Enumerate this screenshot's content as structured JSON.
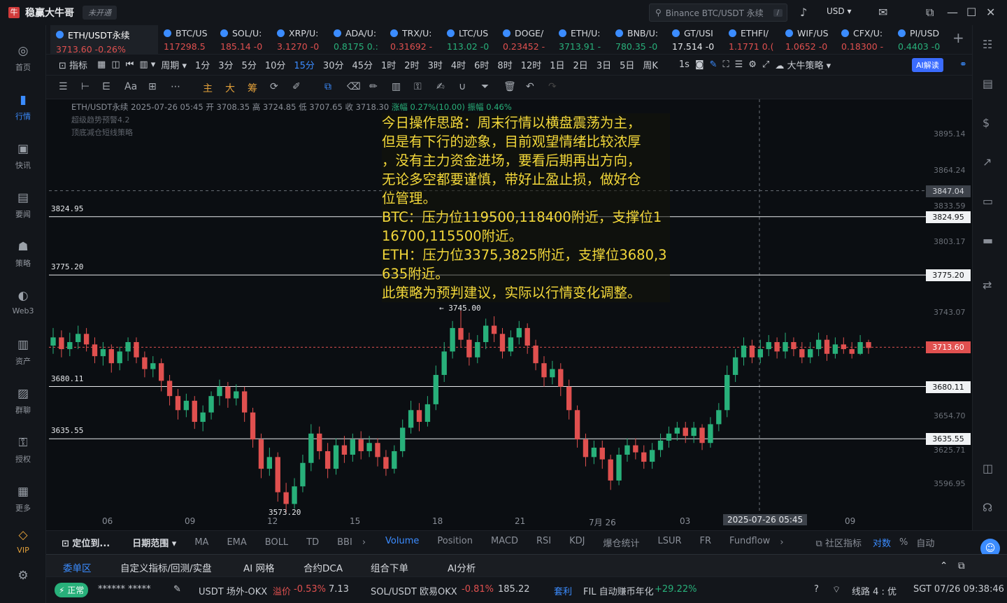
{
  "titlebar": {
    "app_title": "稳赢大牛哥",
    "not_open": "未开通",
    "search_placeholder": "Binance BTC/USDT 永续",
    "currency": "USD"
  },
  "sidebar": {
    "items": [
      {
        "label": "首页",
        "icon": "home-icon"
      },
      {
        "label": "行情",
        "icon": "chart-bars-icon",
        "active": true
      },
      {
        "label": "快讯",
        "icon": "news-icon"
      },
      {
        "label": "要闻",
        "icon": "document-icon"
      },
      {
        "label": "策略",
        "icon": "robot-icon"
      },
      {
        "label": "Web3",
        "icon": "web3-icon"
      },
      {
        "label": "资产",
        "icon": "wallet-icon"
      },
      {
        "label": "群聊",
        "icon": "chat-icon"
      },
      {
        "label": "授权",
        "icon": "key-icon"
      },
      {
        "label": "更多",
        "icon": "grid-icon"
      },
      {
        "label": "VIP",
        "icon": "vip-icon"
      }
    ]
  },
  "tabs": [
    {
      "name": "ETH/USDT永续",
      "value": "3713.60 -0.26%",
      "dir": "down"
    },
    {
      "name": "BTC/US",
      "value": "117298.5",
      "dir": "down"
    },
    {
      "name": "SOL/U:",
      "value": "185.14 -0",
      "dir": "down"
    },
    {
      "name": "XRP/U:",
      "value": "3.1270 -0",
      "dir": "down"
    },
    {
      "name": "ADA/U:",
      "value": "0.8175 0.:",
      "dir": "up"
    },
    {
      "name": "TRX/U:",
      "value": "0.31692 -",
      "dir": "down"
    },
    {
      "name": "LTC/US",
      "value": "113.02 -0",
      "dir": "up"
    },
    {
      "name": "DOGE/",
      "value": "0.23452 -",
      "dir": "down"
    },
    {
      "name": "ETH/U:",
      "value": "3713.91 -",
      "dir": "up"
    },
    {
      "name": "BNB/U:",
      "value": "780.35 -0",
      "dir": "up"
    },
    {
      "name": "GT/USI",
      "value": "17.514 -0",
      "dir": "white"
    },
    {
      "name": "ETHFI/",
      "value": "1.1771 0.(",
      "dir": "down"
    },
    {
      "name": "WIF/US",
      "value": "1.0652 -0",
      "dir": "down"
    },
    {
      "name": "CFX/U:",
      "value": "0.18300 -",
      "dir": "down"
    },
    {
      "name": "PI/USD",
      "value": "0.4403 -0",
      "dir": "up"
    }
  ],
  "toolbar": {
    "indicator": "指标",
    "period": "周期",
    "intervals": [
      "1分",
      "3分",
      "5分",
      "10分",
      "15分",
      "30分",
      "45分",
      "1时",
      "2时",
      "3时",
      "4时",
      "6时",
      "8时",
      "12时",
      "1日",
      "2日",
      "3日",
      "5日",
      "周K"
    ],
    "active_interval": "15分",
    "sec": "1s",
    "strategy": "大牛策略",
    "ai_read": "AI解读"
  },
  "drawbar": {
    "zhu": "主",
    "da": "大",
    "chou": "筹",
    "font": "Aa"
  },
  "chart_header": {
    "info": "ETH/USDT永续 2025-07-26 05:45 开 3708.35 高 3724.85 低 3707.65 收 3718.30",
    "change": "涨幅 0.27%(10.00) 振幅 0.46%",
    "ind1": "超级趋势预警4.2",
    "ind2": "顶底减仓短线策略"
  },
  "annotation": [
    "今日操作思路：周末行情以横盘震荡为主，",
    "但是有下行的迹象，目前观望情绪比较浓厚",
    "，没有主力资金进场，要看后期再出方向，",
    "无论多空都要谨慎，带好止盈止损，做好仓",
    "位管理。",
    "BTC：压力位119500,118400附近，支撑位1",
    "16700,115500附近。",
    "ETH：压力位3375,3825附近，支撑位3680,3",
    "635附近。",
    "此策略为预判建议，实际以行情变化调整。"
  ],
  "chart_data": {
    "type": "candlestick",
    "symbol": "ETH/USDT永续",
    "y_ticks": [
      3895.14,
      3864.24,
      3833.59,
      3803.17,
      3743.07,
      3654.7,
      3625.71,
      3596.95
    ],
    "ylim": [
      3560,
      3920
    ],
    "x_labels": [
      "06",
      "09",
      "12",
      "15",
      "18",
      "21",
      "7月 26",
      "03",
      "2025-07-26 05:45",
      "09"
    ],
    "support_resistance": [
      3824.95,
      3775.2,
      3680.11,
      3635.55
    ],
    "crosshair_price": "3847.04",
    "last_price": "3713.60",
    "high_mark": "← 3745.00",
    "low_mark": "3573.20",
    "candles": [
      {
        "o": 3715,
        "c": 3722,
        "h": 3730,
        "l": 3708
      },
      {
        "o": 3722,
        "c": 3712,
        "h": 3728,
        "l": 3705
      },
      {
        "o": 3712,
        "c": 3718,
        "h": 3726,
        "l": 3706
      },
      {
        "o": 3718,
        "c": 3725,
        "h": 3732,
        "l": 3712
      },
      {
        "o": 3725,
        "c": 3716,
        "h": 3730,
        "l": 3710
      },
      {
        "o": 3716,
        "c": 3706,
        "h": 3722,
        "l": 3700
      },
      {
        "o": 3706,
        "c": 3712,
        "h": 3718,
        "l": 3698
      },
      {
        "o": 3712,
        "c": 3700,
        "h": 3716,
        "l": 3692
      },
      {
        "o": 3700,
        "c": 3710,
        "h": 3714,
        "l": 3694
      },
      {
        "o": 3710,
        "c": 3718,
        "h": 3722,
        "l": 3702
      },
      {
        "o": 3718,
        "c": 3705,
        "h": 3722,
        "l": 3700
      },
      {
        "o": 3705,
        "c": 3695,
        "h": 3710,
        "l": 3688
      },
      {
        "o": 3695,
        "c": 3700,
        "h": 3706,
        "l": 3688
      },
      {
        "o": 3700,
        "c": 3685,
        "h": 3704,
        "l": 3676
      },
      {
        "o": 3685,
        "c": 3672,
        "h": 3690,
        "l": 3664
      },
      {
        "o": 3672,
        "c": 3660,
        "h": 3678,
        "l": 3652
      },
      {
        "o": 3660,
        "c": 3668,
        "h": 3674,
        "l": 3654
      },
      {
        "o": 3668,
        "c": 3650,
        "h": 3672,
        "l": 3644
      },
      {
        "o": 3650,
        "c": 3658,
        "h": 3664,
        "l": 3642
      },
      {
        "o": 3658,
        "c": 3672,
        "h": 3676,
        "l": 3652
      },
      {
        "o": 3672,
        "c": 3680,
        "h": 3686,
        "l": 3664
      },
      {
        "o": 3680,
        "c": 3670,
        "h": 3684,
        "l": 3662
      },
      {
        "o": 3670,
        "c": 3676,
        "h": 3682,
        "l": 3664
      },
      {
        "o": 3676,
        "c": 3658,
        "h": 3680,
        "l": 3650
      },
      {
        "o": 3658,
        "c": 3635,
        "h": 3662,
        "l": 3628
      },
      {
        "o": 3635,
        "c": 3610,
        "h": 3640,
        "l": 3602
      },
      {
        "o": 3610,
        "c": 3620,
        "h": 3628,
        "l": 3604
      },
      {
        "o": 3620,
        "c": 3590,
        "h": 3624,
        "l": 3582
      },
      {
        "o": 3590,
        "c": 3580,
        "h": 3598,
        "l": 3573
      },
      {
        "o": 3580,
        "c": 3595,
        "h": 3602,
        "l": 3576
      },
      {
        "o": 3595,
        "c": 3615,
        "h": 3622,
        "l": 3590
      },
      {
        "o": 3615,
        "c": 3640,
        "h": 3648,
        "l": 3608
      },
      {
        "o": 3640,
        "c": 3625,
        "h": 3646,
        "l": 3618
      },
      {
        "o": 3625,
        "c": 3610,
        "h": 3632,
        "l": 3602
      },
      {
        "o": 3610,
        "c": 3630,
        "h": 3636,
        "l": 3605
      },
      {
        "o": 3630,
        "c": 3622,
        "h": 3638,
        "l": 3615
      },
      {
        "o": 3622,
        "c": 3635,
        "h": 3640,
        "l": 3616
      },
      {
        "o": 3635,
        "c": 3625,
        "h": 3642,
        "l": 3618
      },
      {
        "o": 3625,
        "c": 3632,
        "h": 3638,
        "l": 3620
      },
      {
        "o": 3632,
        "c": 3620,
        "h": 3636,
        "l": 3612
      },
      {
        "o": 3620,
        "c": 3610,
        "h": 3626,
        "l": 3604
      },
      {
        "o": 3610,
        "c": 3625,
        "h": 3630,
        "l": 3606
      },
      {
        "o": 3625,
        "c": 3645,
        "h": 3652,
        "l": 3620
      },
      {
        "o": 3645,
        "c": 3660,
        "h": 3668,
        "l": 3640
      },
      {
        "o": 3660,
        "c": 3650,
        "h": 3666,
        "l": 3642
      },
      {
        "o": 3650,
        "c": 3665,
        "h": 3672,
        "l": 3646
      },
      {
        "o": 3665,
        "c": 3690,
        "h": 3698,
        "l": 3660
      },
      {
        "o": 3690,
        "c": 3710,
        "h": 3718,
        "l": 3684
      },
      {
        "o": 3710,
        "c": 3730,
        "h": 3736,
        "l": 3704
      },
      {
        "o": 3730,
        "c": 3720,
        "h": 3745,
        "l": 3714
      },
      {
        "o": 3720,
        "c": 3705,
        "h": 3726,
        "l": 3698
      },
      {
        "o": 3705,
        "c": 3718,
        "h": 3724,
        "l": 3700
      },
      {
        "o": 3718,
        "c": 3732,
        "h": 3738,
        "l": 3712
      },
      {
        "o": 3732,
        "c": 3725,
        "h": 3740,
        "l": 3718
      },
      {
        "o": 3725,
        "c": 3710,
        "h": 3730,
        "l": 3704
      },
      {
        "o": 3710,
        "c": 3722,
        "h": 3728,
        "l": 3706
      },
      {
        "o": 3722,
        "c": 3730,
        "h": 3736,
        "l": 3716
      },
      {
        "o": 3730,
        "c": 3715,
        "h": 3734,
        "l": 3708
      },
      {
        "o": 3715,
        "c": 3700,
        "h": 3720,
        "l": 3694
      },
      {
        "o": 3700,
        "c": 3688,
        "h": 3706,
        "l": 3680
      },
      {
        "o": 3688,
        "c": 3695,
        "h": 3702,
        "l": 3682
      },
      {
        "o": 3695,
        "c": 3680,
        "h": 3700,
        "l": 3672
      },
      {
        "o": 3680,
        "c": 3660,
        "h": 3686,
        "l": 3652
      },
      {
        "o": 3660,
        "c": 3635,
        "h": 3664,
        "l": 3628
      },
      {
        "o": 3635,
        "c": 3620,
        "h": 3640,
        "l": 3612
      },
      {
        "o": 3620,
        "c": 3628,
        "h": 3634,
        "l": 3614
      },
      {
        "o": 3628,
        "c": 3618,
        "h": 3634,
        "l": 3610
      },
      {
        "o": 3618,
        "c": 3600,
        "h": 3622,
        "l": 3592
      },
      {
        "o": 3600,
        "c": 3622,
        "h": 3628,
        "l": 3596
      },
      {
        "o": 3622,
        "c": 3630,
        "h": 3636,
        "l": 3616
      },
      {
        "o": 3630,
        "c": 3624,
        "h": 3636,
        "l": 3618
      },
      {
        "o": 3624,
        "c": 3616,
        "h": 3630,
        "l": 3610
      },
      {
        "o": 3616,
        "c": 3626,
        "h": 3632,
        "l": 3610
      },
      {
        "o": 3626,
        "c": 3634,
        "h": 3640,
        "l": 3620
      },
      {
        "o": 3634,
        "c": 3640,
        "h": 3646,
        "l": 3628
      },
      {
        "o": 3640,
        "c": 3645,
        "h": 3650,
        "l": 3634
      },
      {
        "o": 3645,
        "c": 3638,
        "h": 3650,
        "l": 3632
      },
      {
        "o": 3638,
        "c": 3645,
        "h": 3650,
        "l": 3632
      },
      {
        "o": 3645,
        "c": 3632,
        "h": 3648,
        "l": 3626
      },
      {
        "o": 3632,
        "c": 3648,
        "h": 3654,
        "l": 3628
      },
      {
        "o": 3648,
        "c": 3660,
        "h": 3666,
        "l": 3642
      },
      {
        "o": 3660,
        "c": 3690,
        "h": 3698,
        "l": 3654
      },
      {
        "o": 3690,
        "c": 3705,
        "h": 3712,
        "l": 3684
      },
      {
        "o": 3705,
        "c": 3715,
        "h": 3722,
        "l": 3698
      },
      {
        "o": 3715,
        "c": 3705,
        "h": 3720,
        "l": 3700
      },
      {
        "o": 3705,
        "c": 3712,
        "h": 3720,
        "l": 3700
      },
      {
        "o": 3712,
        "c": 3718,
        "h": 3724,
        "l": 3706
      },
      {
        "o": 3718,
        "c": 3710,
        "h": 3722,
        "l": 3704
      },
      {
        "o": 3710,
        "c": 3718,
        "h": 3726,
        "l": 3704
      },
      {
        "o": 3718,
        "c": 3712,
        "h": 3722,
        "l": 3706
      },
      {
        "o": 3712,
        "c": 3705,
        "h": 3718,
        "l": 3700
      },
      {
        "o": 3705,
        "c": 3712,
        "h": 3718,
        "l": 3700
      },
      {
        "o": 3712,
        "c": 3720,
        "h": 3726,
        "l": 3706
      },
      {
        "o": 3720,
        "c": 3708,
        "h": 3724,
        "l": 3702
      },
      {
        "o": 3708,
        "c": 3716,
        "h": 3722,
        "l": 3704
      },
      {
        "o": 3716,
        "c": 3712,
        "h": 3722,
        "l": 3708
      },
      {
        "o": 3712,
        "c": 3708,
        "h": 3718,
        "l": 3704
      },
      {
        "o": 3708,
        "c": 3718,
        "h": 3724,
        "l": 3707
      },
      {
        "o": 3718,
        "c": 3713,
        "h": 3720,
        "l": 3708
      }
    ]
  },
  "indicators_bar": {
    "locate": "定位到...",
    "date_range": "日期范围",
    "items": [
      "MA",
      "EMA",
      "BOLL",
      "TD",
      "BBI"
    ],
    "items2": [
      "Volume",
      "Position",
      "MACD",
      "RSI",
      "KDJ",
      "爆仓统计",
      "LSUR",
      "FR",
      "Fundflow"
    ],
    "active": "Volume",
    "community": "社区指标",
    "log": "对数",
    "pct": "%",
    "auto": "自动"
  },
  "bottom_tabs": [
    "委单区",
    "自定义指标/回测/实盘",
    "AI 网格",
    "合约DCA",
    "组合下单",
    "AI分析"
  ],
  "statusbar": {
    "normal": "正常",
    "user": "******  *****",
    "usdt": "USDT 场外-OKX",
    "premium_label": "溢价",
    "premium": "-0.53%",
    "premium_val": "7.13",
    "sol": "SOL/USDT 欧易OKX",
    "sol_chg": "-0.81%",
    "sol_val": "185.22",
    "arb": "套利",
    "fil": "FIL 自动赚币年化",
    "fil_chg": "+29.22%",
    "line": "线路 4 : 优",
    "time": "SGT 07/26 09:38:46"
  },
  "colors": {
    "up": "#28b07a",
    "down": "#e0504f",
    "accent": "#3b8cff",
    "annot": "#f3d83a"
  }
}
